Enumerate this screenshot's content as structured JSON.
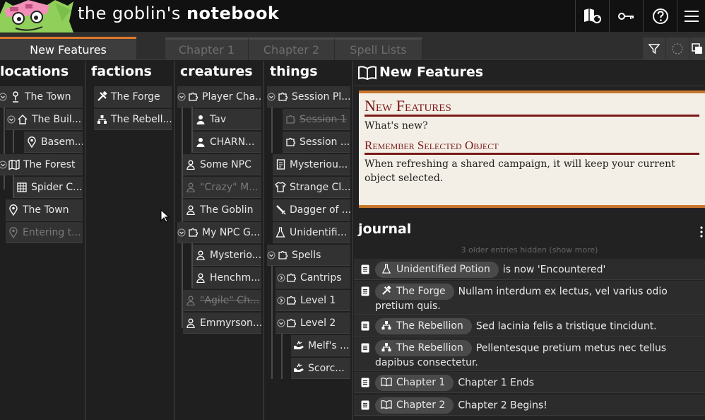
{
  "app": {
    "title_regular": "the goblin's ",
    "title_bold": "notebook"
  },
  "header_icons": [
    "map-sync-icon",
    "key-icon",
    "help-icon",
    "menu-icon"
  ],
  "tabs": [
    {
      "label": "New Features",
      "active": true
    },
    {
      "label": "Chapter 1",
      "active": false
    },
    {
      "label": "Chapter 2",
      "active": false
    },
    {
      "label": "Spell Lists",
      "active": false
    }
  ],
  "columns": {
    "locations": {
      "title": "locations",
      "items": [
        "The Town",
        "The Buil...",
        "Basem...",
        "The Forest",
        "Spider C...",
        "The Town",
        "Entering t..."
      ]
    },
    "factions": {
      "title": "factions",
      "items": [
        "The Forge",
        "The Rebell..."
      ]
    },
    "creatures": {
      "title": "creatures",
      "items": [
        "Player Cha...",
        "Tav",
        "CHARN...",
        "Some NPC",
        "\"Crazy\" M...",
        "The Goblin",
        "My NPC G...",
        "Mysterio...",
        "Henchm...",
        "\"Agile\" Ch...",
        "Emmyrson..."
      ]
    },
    "things": {
      "title": "things",
      "items": [
        "Session Pl...",
        "Session 1",
        "Session ...",
        "Mysteriou...",
        "Strange Cl...",
        "Dagger of ...",
        "Unidentifi...",
        "Spells",
        "Cantrips",
        "Level 1",
        "Level 2",
        "Melf's ...",
        "Scorc..."
      ]
    }
  },
  "panel": {
    "title": "New Features",
    "doc": {
      "h1": "New Features",
      "p1": "What's new?",
      "h2": "Remember Selected Object",
      "p2": "When refreshing a shared campaign, it will keep your current object selected."
    }
  },
  "journal": {
    "title": "journal",
    "hidden_note": "3 older entries hidden (show more)",
    "entries": [
      {
        "tag": "Unidentified Potion",
        "icon": "flask-icon",
        "text": "is now 'Encountered'"
      },
      {
        "tag": "The Forge",
        "icon": "tools-icon",
        "text": "Nullam interdum ex lectus, vel varius odio pretium quis."
      },
      {
        "tag": "The Rebellion",
        "icon": "faction-icon",
        "text": "Sed lacinia felis a tristique tincidunt."
      },
      {
        "tag": "The Rebellion",
        "icon": "faction-icon",
        "text": "Pellentesque pretium metus nec tellus dapibus consectetur."
      },
      {
        "tag": "Chapter 1",
        "icon": "book-icon",
        "text": "Chapter 1 Ends"
      },
      {
        "tag": "Chapter 2",
        "icon": "book-icon",
        "text": "Chapter 2 Begins!"
      }
    ]
  },
  "colors": {
    "accent": "#e07a2a",
    "doc_heading": "#7a1818",
    "doc_bg": "#f3efe6"
  }
}
